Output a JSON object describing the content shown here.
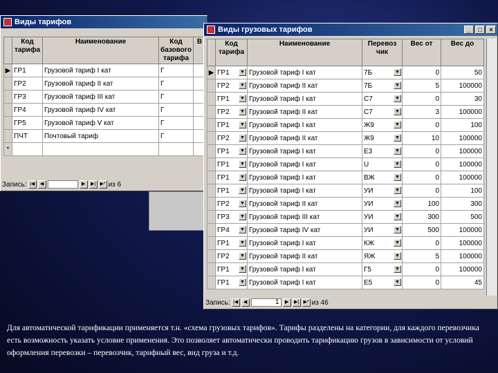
{
  "back_window": {
    "title": "Виды тарифов",
    "headers": [
      "Код тарифа",
      "Наименование",
      "Код базового тарифа",
      "В"
    ],
    "rows": [
      {
        "code": "ГР1",
        "name": "Грузовой тариф I кат",
        "base": "Г"
      },
      {
        "code": "ГР2",
        "name": "Грузовой тариф II кат",
        "base": "Г"
      },
      {
        "code": "ГР3",
        "name": "Грузовой тариф III кат",
        "base": "Г"
      },
      {
        "code": "ГР4",
        "name": "Грузовой тариф IV кат",
        "base": "Г"
      },
      {
        "code": "ГР5",
        "name": "Грузовой тариф V кат",
        "base": "Г"
      },
      {
        "code": "ПЧТ",
        "name": "Почтовый тариф",
        "base": "Г"
      }
    ],
    "new_row_marker": "*",
    "current_row_marker": "▶",
    "nav": {
      "label": "Запись:",
      "total": "из 6"
    }
  },
  "front_window": {
    "title": "Виды грузовых тарифов",
    "headers": [
      "Код тарифа",
      "Наименование",
      "Перевоз чик",
      "Вес от",
      "Вес до"
    ],
    "rows": [
      {
        "code": "ГР1",
        "name": "Грузовой тариф I кат",
        "carrier": "7Б",
        "from": "0",
        "to": "50"
      },
      {
        "code": "ГР2",
        "name": "Грузовой тариф II кат",
        "carrier": "7Б",
        "from": "5",
        "to": "100000"
      },
      {
        "code": "ГР1",
        "name": "Грузовой тариф I кат",
        "carrier": "С7",
        "from": "0",
        "to": "30"
      },
      {
        "code": "ГР2",
        "name": "Грузовой тариф II кат",
        "carrier": "С7",
        "from": "3",
        "to": "100000"
      },
      {
        "code": "ГР1",
        "name": "Грузовой тариф I кат",
        "carrier": "Ж9",
        "from": "0",
        "to": "100"
      },
      {
        "code": "ГР2",
        "name": "Грузовой тариф II кат",
        "carrier": "Ж9",
        "from": "10",
        "to": "100000"
      },
      {
        "code": "ГР1",
        "name": "Грузовой тариф I кат",
        "carrier": "Е3",
        "from": "0",
        "to": "100000"
      },
      {
        "code": "ГР1",
        "name": "Грузовой тариф I кат",
        "carrier": "U",
        "from": "0",
        "to": "100000"
      },
      {
        "code": "ГР1",
        "name": "Грузовой тариф I кат",
        "carrier": "ВЖ",
        "from": "0",
        "to": "100000"
      },
      {
        "code": "ГР1",
        "name": "Грузовой тариф I кат",
        "carrier": "УИ",
        "from": "0",
        "to": "100"
      },
      {
        "code": "ГР2",
        "name": "Грузовой тариф II кат",
        "carrier": "УИ",
        "from": "100",
        "to": "300"
      },
      {
        "code": "ГР3",
        "name": "Грузовой тариф III кат",
        "carrier": "УИ",
        "from": "300",
        "to": "500"
      },
      {
        "code": "ГР4",
        "name": "Грузовой тариф IV кат",
        "carrier": "УИ",
        "from": "500",
        "to": "100000"
      },
      {
        "code": "ГР1",
        "name": "Грузовой тариф I кат",
        "carrier": "КЖ",
        "from": "0",
        "to": "100000"
      },
      {
        "code": "ГР2",
        "name": "Грузовой тариф II кат",
        "carrier": "ЯЖ",
        "from": "5",
        "to": "100000"
      },
      {
        "code": "ГР1",
        "name": "Грузовой тариф I кат",
        "carrier": "Г5",
        "from": "0",
        "to": "100000"
      },
      {
        "code": "ГР1",
        "name": "Грузовой тариф I кат",
        "carrier": "Е5",
        "from": "0",
        "to": "45"
      }
    ],
    "current_row_marker": "▶",
    "nav": {
      "label": "Запись:",
      "current": "1",
      "total": "из 46"
    }
  },
  "caption": "Для автоматической тарификации применяется т.н. «схема грузовых тарифов». Тарифы разделены на категории, для каждого перевозчика есть возможность указать условие применения. Это позволяет автоматически проводить тарификацию грузов в зависимости от условий оформления перевозки – перевозчик, тарифный вес, вид груза и т.д."
}
